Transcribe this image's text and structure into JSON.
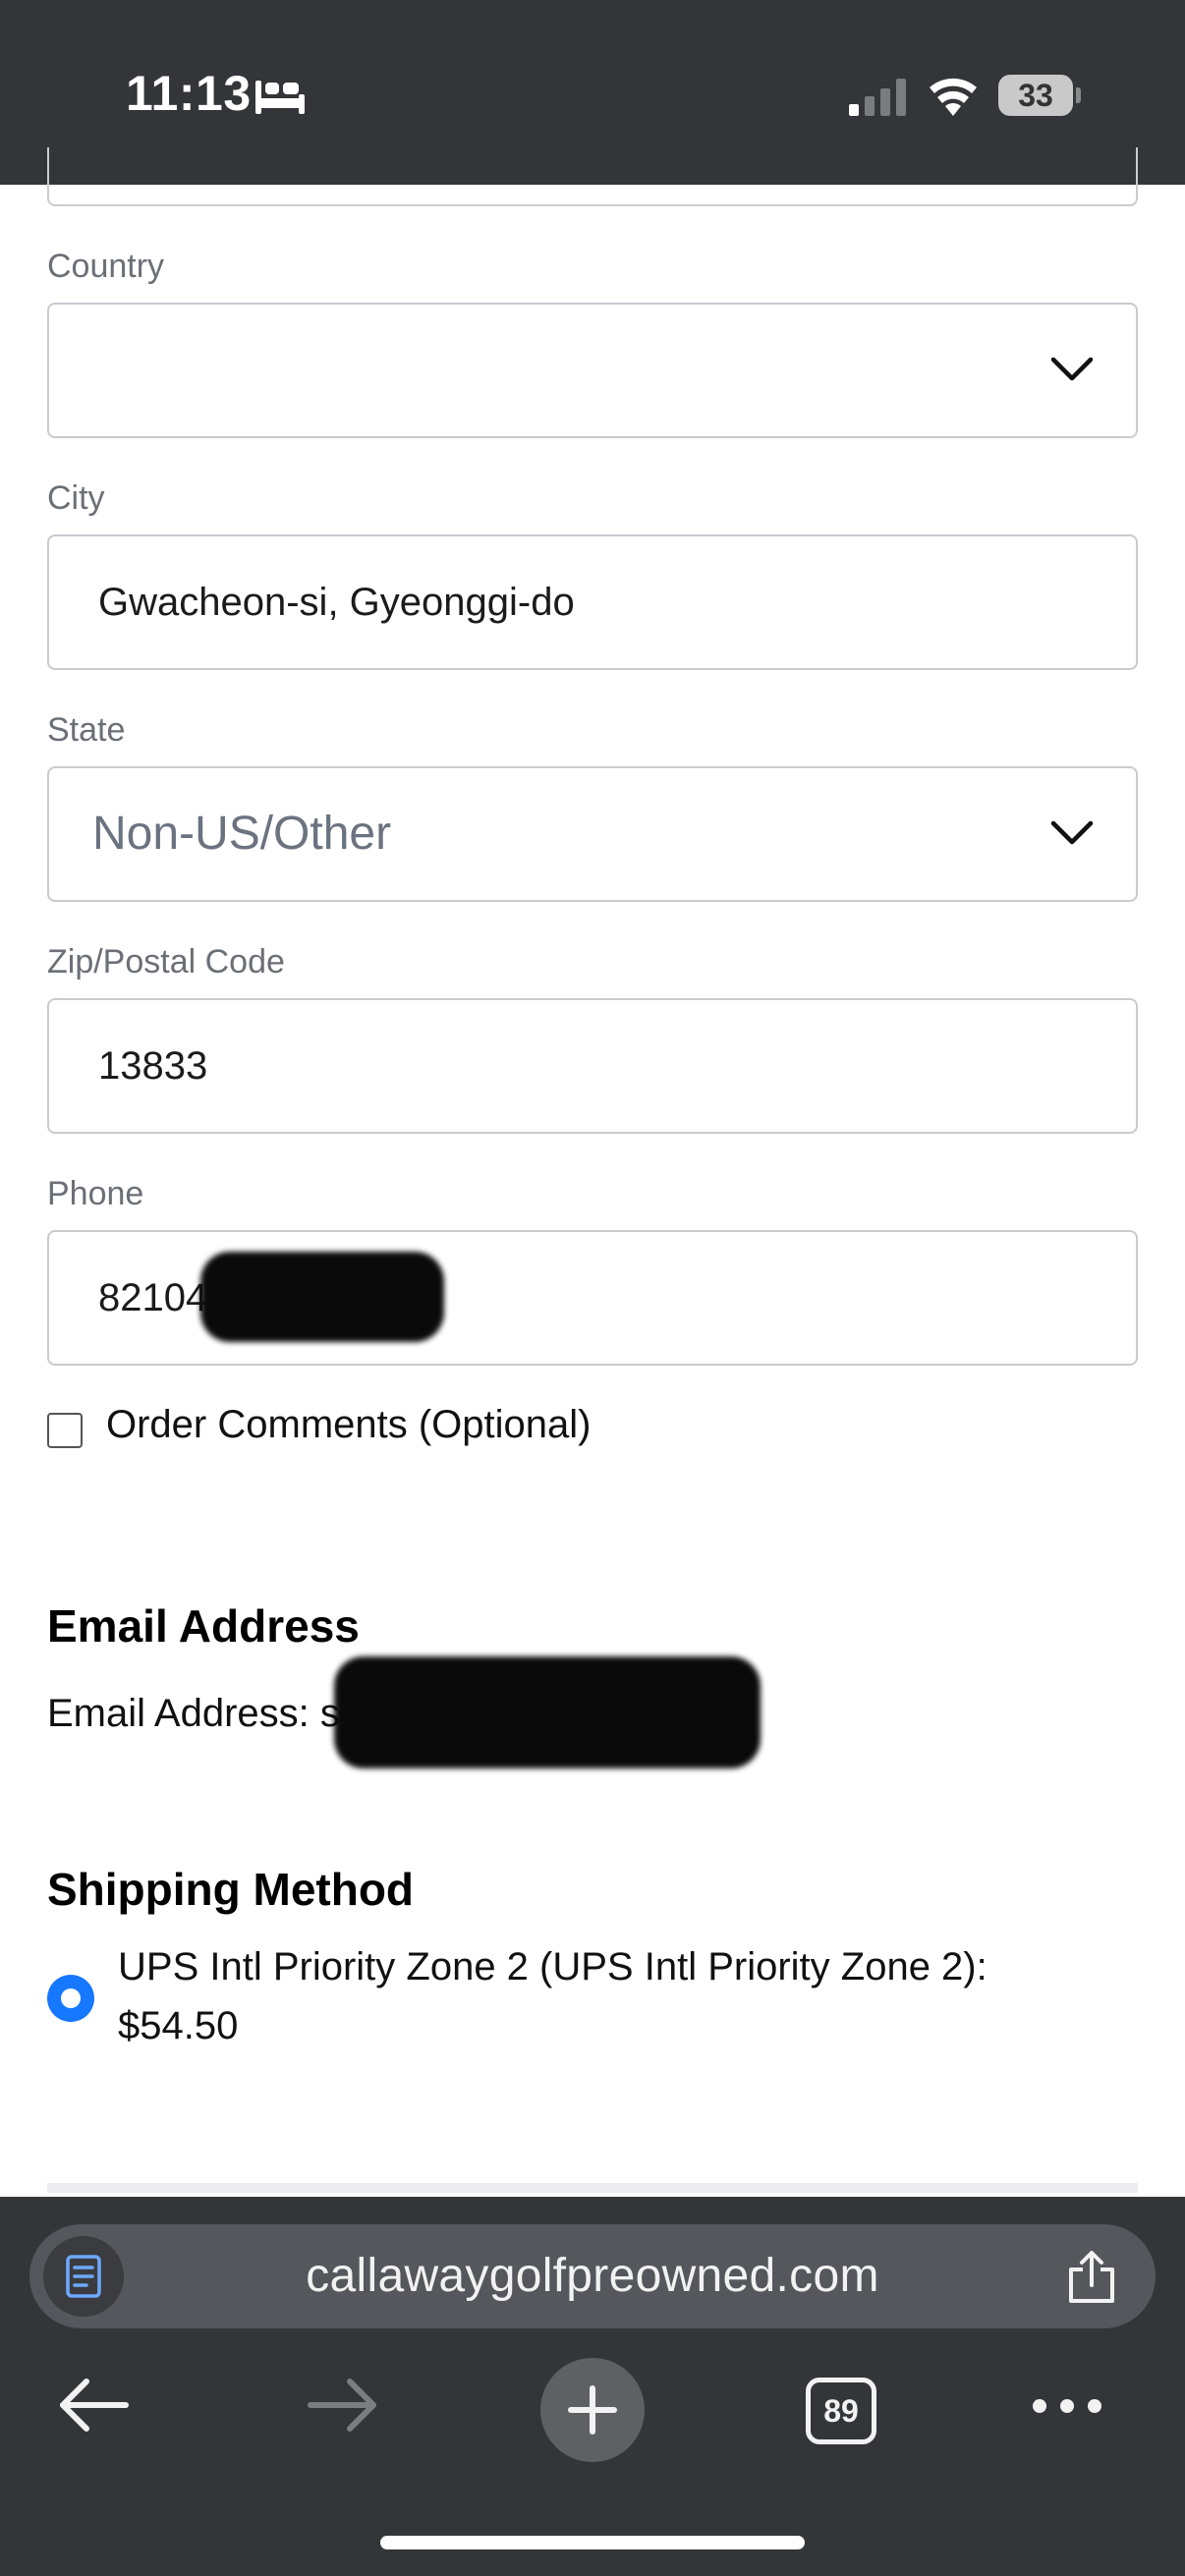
{
  "status_bar": {
    "time": "11:13",
    "battery": "33"
  },
  "form": {
    "country": {
      "label": "Country",
      "value": ""
    },
    "city": {
      "label": "City",
      "value": "Gwacheon-si, Gyeonggi-do"
    },
    "state": {
      "label": "State",
      "placeholder": "Non-US/Other"
    },
    "zip": {
      "label": "Zip/Postal Code",
      "value": "13833"
    },
    "phone": {
      "label": "Phone",
      "value": "821049030522"
    },
    "order_comments": {
      "label": "Order Comments (Optional)",
      "checked": false
    }
  },
  "email_section": {
    "title": "Email Address",
    "line": "Email Address: spur0522@gmail.com"
  },
  "shipping": {
    "title": "Shipping Method",
    "option_label": "UPS Intl Priority Zone 2 (UPS Intl Priority Zone 2): $54.50",
    "selected": true
  },
  "browser": {
    "url": "callawaygolfpreowned.com",
    "tab_count": "89"
  },
  "colors": {
    "chrome_bg": "#333539",
    "url_pill": "#55575c",
    "accent_blue": "#1677ff",
    "field_border": "#c8cbd0",
    "label_gray": "#6b6f76"
  }
}
